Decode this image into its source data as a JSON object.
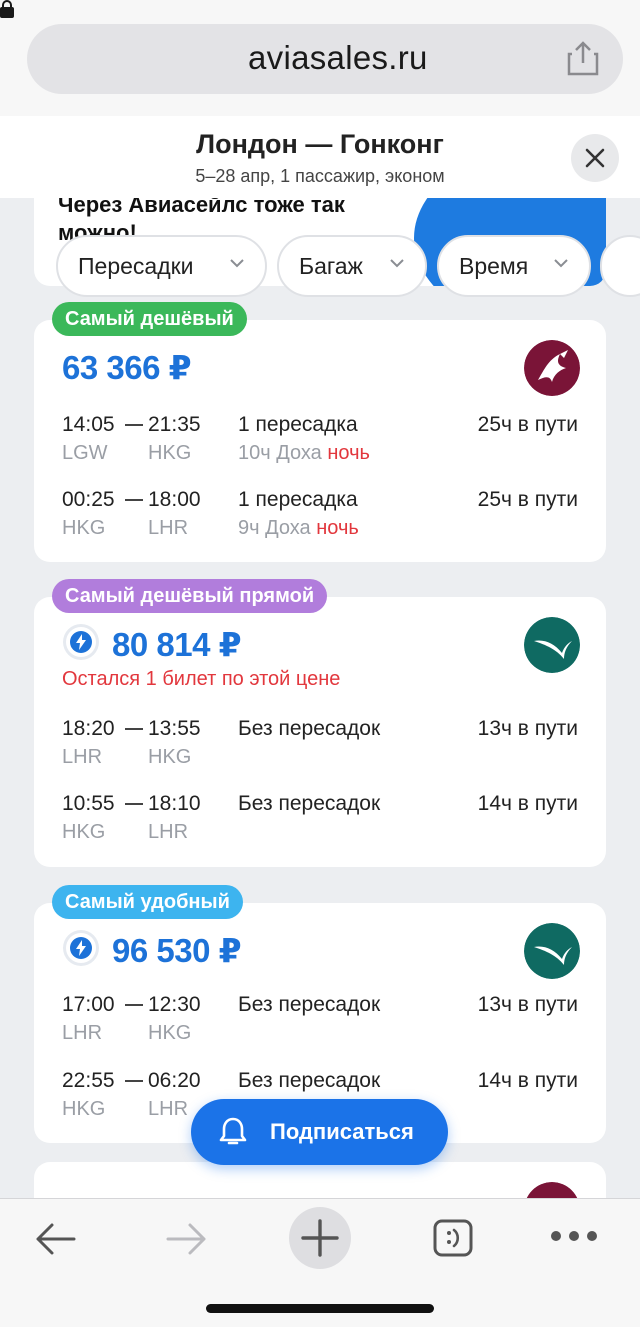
{
  "browser": {
    "url": "aviasales.ru"
  },
  "header": {
    "title": "Лондон — Гонконг",
    "subtitle": "5–28 апр, 1 пассажир, эконом"
  },
  "promo": {
    "text": "Через Авиасейлс тоже так можно!"
  },
  "filters": [
    {
      "label": "Пересадки"
    },
    {
      "label": "Багаж"
    },
    {
      "label": "Время"
    }
  ],
  "tickets": [
    {
      "badge": "Самый дешёвый",
      "badge_color": "#3bb85a",
      "price": "63 366 ₽",
      "airline_logo": "qatar-airways-logo",
      "segments": [
        {
          "dep_time": "14:05",
          "arr_time": "21:35",
          "dep_code": "LGW",
          "arr_code": "HKG",
          "stops": "1 пересадка",
          "stop_detail": "10ч Доха",
          "stop_flag": "ночь",
          "duration": "25ч в пути"
        },
        {
          "dep_time": "00:25",
          "arr_time": "18:00",
          "dep_code": "HKG",
          "arr_code": "LHR",
          "stops": "1 пересадка",
          "stop_detail": "9ч Доха",
          "stop_flag": "ночь",
          "duration": "25ч в пути"
        }
      ]
    },
    {
      "badge": "Самый дешёвый прямой",
      "badge_color": "#b17ddc",
      "price": "80 814 ₽",
      "alert": "Остался 1 билет по этой цене",
      "airline_logo": "cathay-pacific-logo",
      "segments": [
        {
          "dep_time": "18:20",
          "arr_time": "13:55",
          "dep_code": "LHR",
          "arr_code": "HKG",
          "stops": "Без пересадок",
          "duration": "13ч в пути"
        },
        {
          "dep_time": "10:55",
          "arr_time": "18:10",
          "dep_code": "HKG",
          "arr_code": "LHR",
          "stops": "Без пересадок",
          "duration": "14ч в пути"
        }
      ]
    },
    {
      "badge": "Самый удобный",
      "badge_color": "#3db4ef",
      "price": "96 530 ₽",
      "airline_logo": "cathay-pacific-logo",
      "segments": [
        {
          "dep_time": "17:00",
          "arr_time": "12:30",
          "dep_code": "LHR",
          "arr_code": "HKG",
          "stops": "Без пересадок",
          "duration": "13ч в пути"
        },
        {
          "dep_time": "22:55",
          "arr_time": "06:20",
          "dep_code": "HKG",
          "arr_code": "LHR",
          "stops": "Без пересадок",
          "duration": "14ч в пути"
        }
      ]
    }
  ],
  "subscribe": {
    "label": "Подписаться"
  },
  "colors": {
    "accent": "#1b73e8",
    "price": "#1d72d8",
    "alert": "#e2373d",
    "qatar": "#7a1437",
    "cathay": "#0f6a62"
  },
  "toolbar_icons": [
    "back-arrow-icon",
    "forward-arrow-icon",
    "new-tab-plus-icon",
    "tabs-icon",
    "more-icon"
  ]
}
